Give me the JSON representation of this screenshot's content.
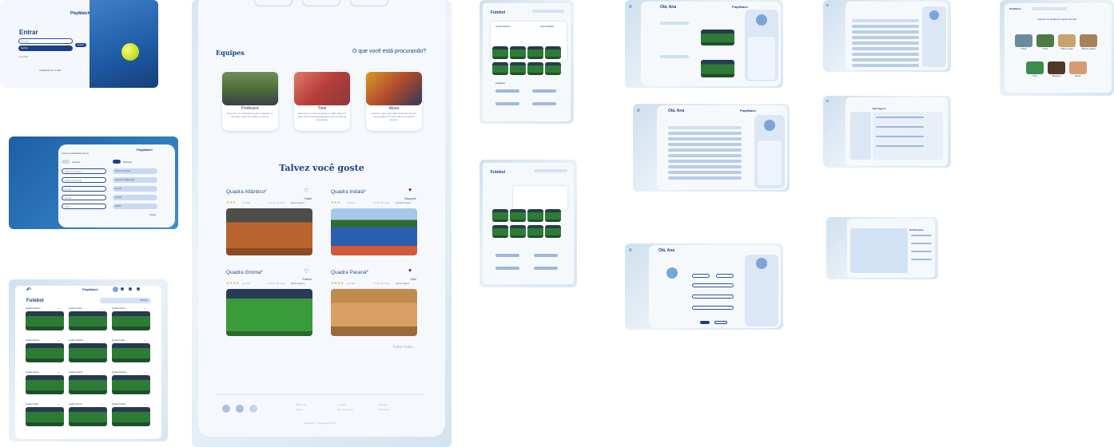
{
  "brand": "PlayMatch",
  "login": {
    "title": "Entrar",
    "email_placeholder": "E-mail",
    "password_placeholder": "Senha",
    "button": "Entrar",
    "register_link": "Cadastrar-se no site!",
    "remember": "Lembrar"
  },
  "signup": {
    "title": "Você se Cadastrar Como:",
    "option1": "Usuário",
    "option2": "Parceiro",
    "fields_left": [
      "Nome (completo)",
      "Nome (empresa)",
      "E-mail",
      "Senha",
      "CPF"
    ],
    "fields_right": [
      "Nome completo",
      "Quadra cadastrada",
      "E-mail",
      "Senha",
      "CNPJ"
    ],
    "submit": "Salvar"
  },
  "list": {
    "title": "Futebol",
    "search_placeholder": "Buscar",
    "items": [
      "Quadra Atlântico",
      "Quadra Indaiá",
      "Quadra Groma",
      "Quadra Paraná",
      "Quadra Atlântico",
      "Quadra Indaiá",
      "Quadra Groma",
      "Quadra Paraná",
      "Quadra Atlântico",
      "Quadra Indaiá",
      "Quadra Groma",
      "Quadra Paraná"
    ]
  },
  "main": {
    "teams_title": "Equipes",
    "teams_link": "O que você está procurando?",
    "teams": [
      {
        "name": "Professor",
        "desc": "Encontre um profissional para te ajudar em seu jogo, seja com aulas ou treinos."
      },
      {
        "name": "Time",
        "desc": "Está sem um time completo ou falta alguém? Aqui você encontra jogadores para completar sua equipe."
      },
      {
        "name": "Aluno",
        "desc": "Ensine o que você sabe! Encontre alunos interessados em aprender seu esporte favorito."
      }
    ],
    "suggest_title": "Talvez você goste",
    "courts": [
      {
        "name": "Quadra Atlântico*",
        "sport": "Futsal",
        "rating": "4.1 (29)",
        "stars": 3,
        "dist": "0,5 km de você,",
        "status": "aberto agora",
        "liked": false
      },
      {
        "name": "Quadra Indaiá*",
        "sport": "Basquete",
        "rating": "4.0 (11)",
        "stars": 3,
        "dist": "0,5 km de você,",
        "status": "fechado agora",
        "liked": true
      },
      {
        "name": "Quadra Groma*",
        "sport": "Futebol",
        "rating": "4.2 (30)",
        "stars": 4,
        "dist": "0,5 km de você,",
        "status": "aberto agora",
        "liked": false
      },
      {
        "name": "Quadra Paraná*",
        "sport": "Vôlei",
        "rating": "4.4 (23)",
        "stars": 4,
        "dist": "2,1 km de você,",
        "status": "aberto agora",
        "liked": true
      }
    ],
    "see_more": "Saiba mais...",
    "footer_cols": [
      [
        "Sobre nós",
        "Equipe"
      ],
      [
        "Contato",
        "Termos de uso"
      ],
      [
        "Dúvidas",
        "Parceiros"
      ]
    ],
    "copyright": "PlayMatch · Copyright © 2024"
  },
  "sport_screen": {
    "title": "Futebol",
    "filter1": "Quadra Atlântico",
    "filter2": "Disponibilidade",
    "reviews_label": "Avaliações"
  },
  "profile": {
    "greeting": "Olá, Ana",
    "user": "Ana Julia",
    "sections": [
      "Reservas ativas",
      "Histórico"
    ],
    "tabs": [
      "Reservas",
      "Favoritos",
      "Conta"
    ]
  },
  "sports_menu": {
    "heading": "Agende sua quadra de esporte favorita:",
    "sports": [
      "Futsal",
      "Tênis",
      "Vôlei de praia",
      "Vôlei de quadra",
      "Pista",
      "Basquete",
      "Beach"
    ]
  },
  "chat": {
    "title": "Mensagens",
    "page_title": "Notificações"
  },
  "colors": {
    "primary": "#1d3f8a",
    "accent": "#2c4f95",
    "light": "#cfe0f6",
    "bg": "#e6eef7"
  }
}
